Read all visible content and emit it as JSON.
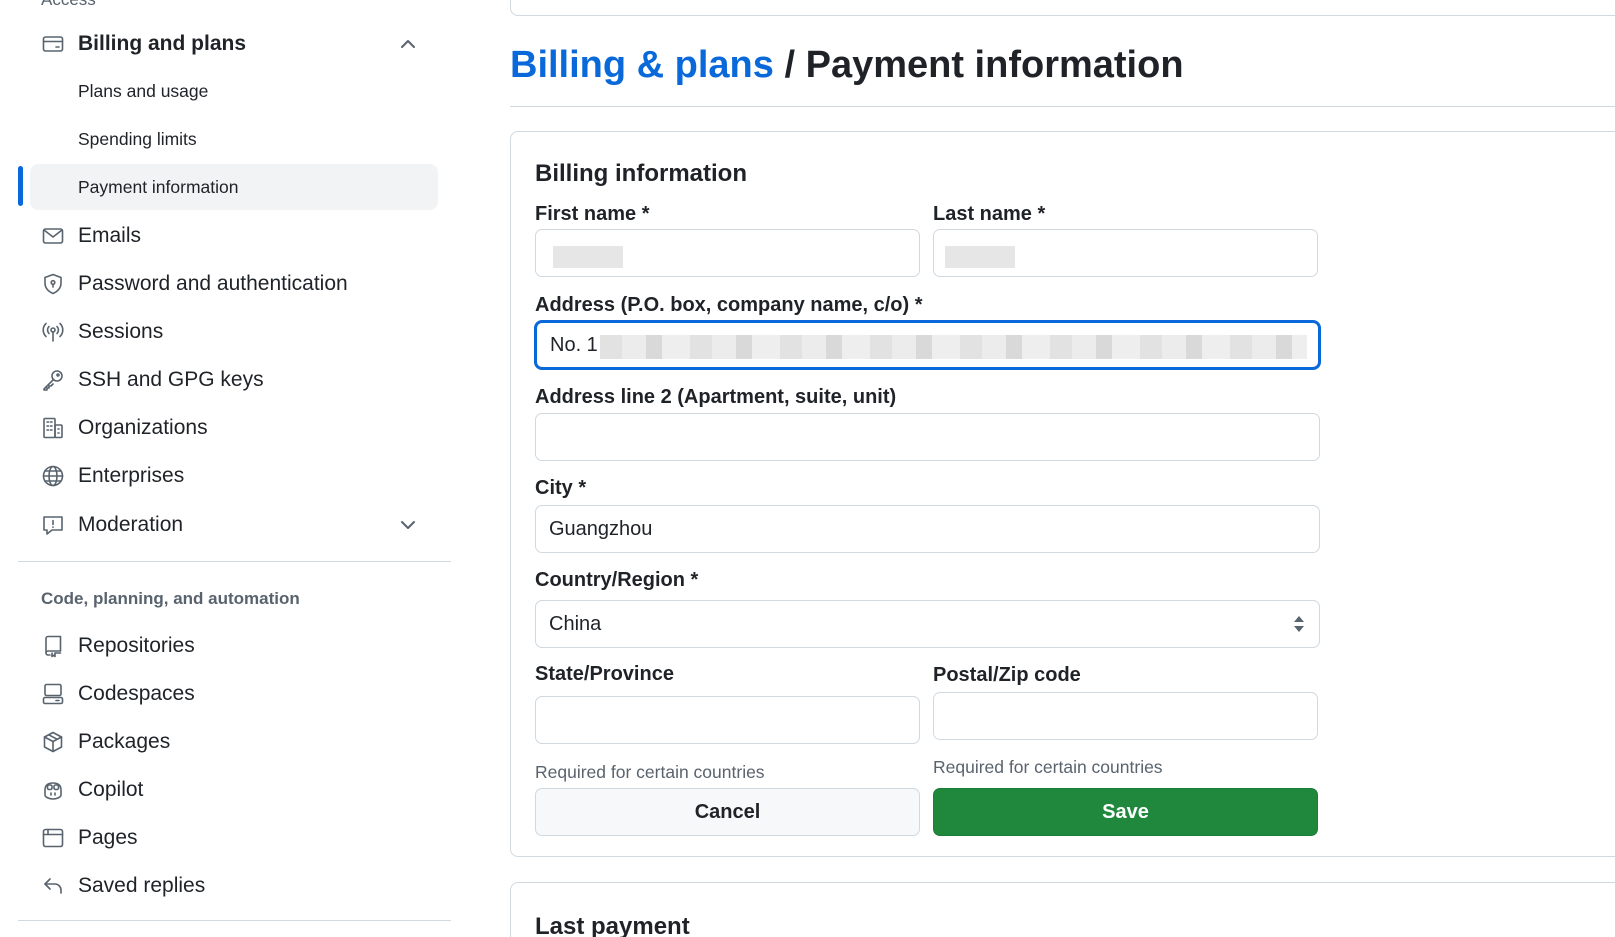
{
  "sidebar": {
    "partial_heading": "Access",
    "billing": {
      "label": "Billing and plans",
      "subitems": [
        "Plans and usage",
        "Spending limits",
        "Payment information"
      ]
    },
    "items": [
      "Emails",
      "Password and authentication",
      "Sessions",
      "SSH and GPG keys",
      "Organizations",
      "Enterprises",
      "Moderation"
    ],
    "group_heading": "Code, planning, and automation",
    "group_items": [
      "Repositories",
      "Codespaces",
      "Packages",
      "Copilot",
      "Pages",
      "Saved replies"
    ]
  },
  "header": {
    "breadcrumb": "Billing & plans",
    "separator": "/",
    "title": "Payment information"
  },
  "form": {
    "heading": "Billing information",
    "first_name_label": "First name *",
    "last_name_label": "Last name *",
    "address_label": "Address (P.O. box, company name, c/o) *",
    "address_value": "No. 1",
    "address2_label": "Address line 2 (Apartment, suite, unit)",
    "city_label": "City *",
    "city_value": "Guangzhou",
    "country_label": "Country/Region *",
    "country_value": "China",
    "state_label": "State/Province",
    "postal_label": "Postal/Zip code",
    "state_hint": "Required for certain countries",
    "postal_hint": "Required for certain countries",
    "cancel_label": "Cancel",
    "save_label": "Save"
  },
  "last_payment": {
    "heading": "Last payment"
  },
  "colors": {
    "accent": "#0969da",
    "save_button": "#1f883d"
  }
}
